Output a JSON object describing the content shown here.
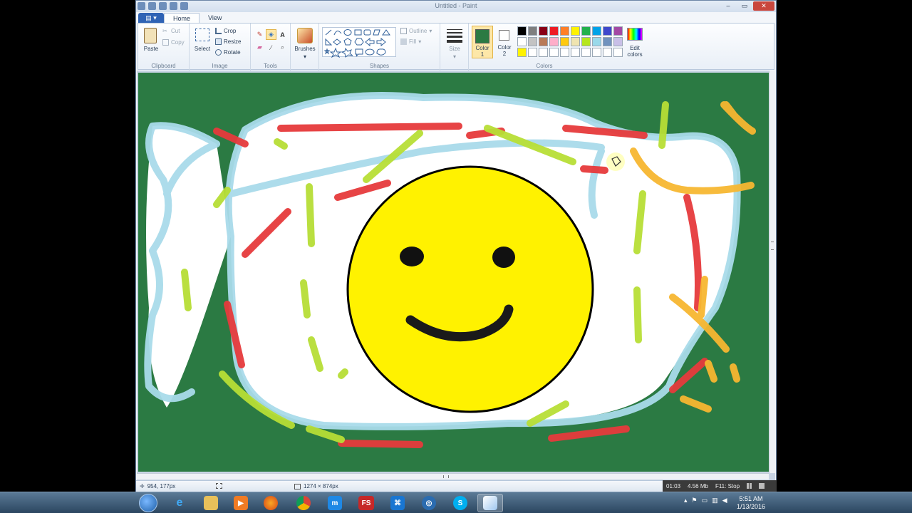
{
  "window": {
    "title": "Untitled - Paint",
    "controls": {
      "minimize": "–",
      "maximize": "▭",
      "close": "✕"
    }
  },
  "tabs": {
    "app_menu": "▤ ▾",
    "home": "Home",
    "view": "View"
  },
  "ribbon": {
    "clipboard": {
      "label": "Clipboard",
      "paste": "Paste",
      "cut": "Cut",
      "copy": "Copy"
    },
    "image": {
      "label": "Image",
      "select": "Select",
      "crop": "Crop",
      "resize": "Resize",
      "rotate": "Rotate"
    },
    "tools": {
      "label": "Tools"
    },
    "brushes": {
      "label": "Brushes"
    },
    "shapes": {
      "label": "Shapes",
      "outline": "Outline",
      "fill": "Fill"
    },
    "size": {
      "label": "Size"
    },
    "colors": {
      "label": "Colors",
      "color1_label": "Color",
      "color1_num": "1",
      "color2_label": "Color",
      "color2_num": "2",
      "edit_colors_1": "Edit",
      "edit_colors_2": "colors",
      "color1": "#2b7a43",
      "color2": "#ffffff",
      "palette_row1": [
        "#000000",
        "#7f7f7f",
        "#880015",
        "#ed1c24",
        "#ff7f27",
        "#fff200",
        "#22b14c",
        "#00a2e8",
        "#3f48cc",
        "#a349a4"
      ],
      "palette_row2": [
        "#ffffff",
        "#c3c3c3",
        "#b97a57",
        "#ffaec9",
        "#ffc90e",
        "#efe4b0",
        "#b5e61d",
        "#99d9ea",
        "#7092be",
        "#c8bfe7"
      ],
      "palette_row3": [
        "#fff200",
        "#ffffff",
        "#ffffff",
        "#ffffff",
        "#ffffff",
        "#ffffff",
        "#ffffff",
        "#ffffff",
        "#ffffff",
        "#ffffff"
      ]
    }
  },
  "status": {
    "cursor_pos": "954, 177px",
    "image_size": "1274 × 874px"
  },
  "recorder": {
    "time": "01:03",
    "size": "4.56 Mb",
    "stop": "F11: Stop"
  },
  "taskbar": {
    "apps": [
      "ie-icon",
      "explorer-icon",
      "media-player-icon",
      "firefox-icon",
      "chrome-icon",
      "maxthon-icon",
      "fs-app",
      "app-icon",
      "app-icon-2",
      "skype-icon",
      "paint-icon"
    ],
    "fs_label": "FS",
    "clock_time": "5:51 AM",
    "clock_date": "1/13/2016"
  }
}
